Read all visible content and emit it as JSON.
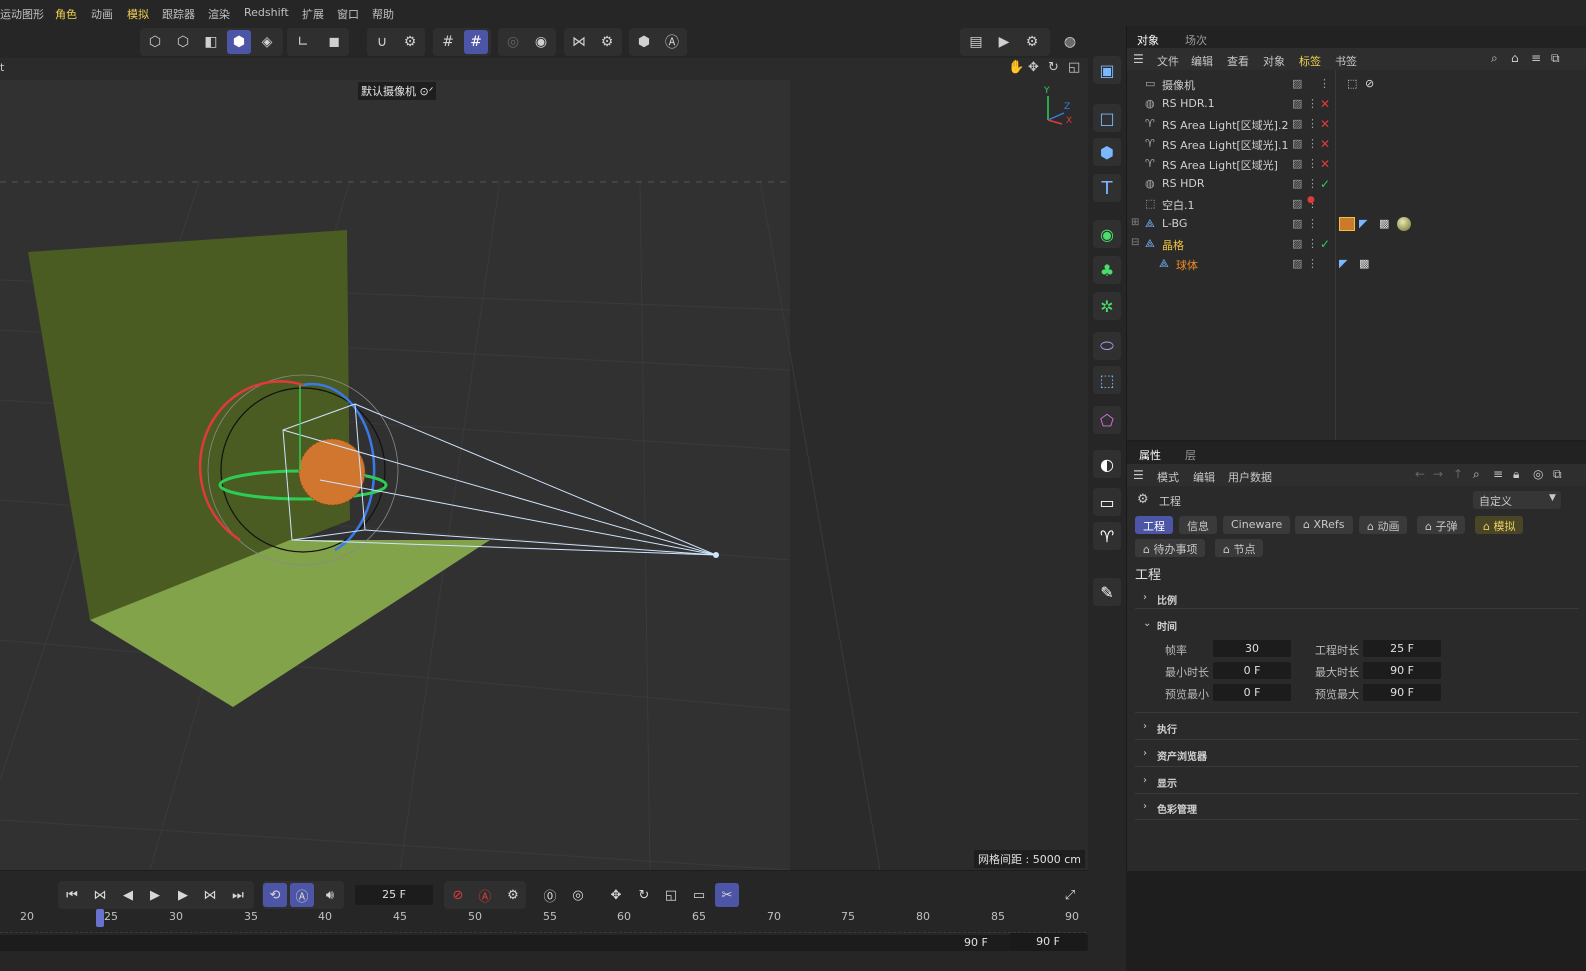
{
  "menubar": {
    "items": [
      "运动图形",
      "角色",
      "动画",
      "模拟",
      "跟踪器",
      "渲染",
      "Redshift",
      "扩展",
      "窗口",
      "帮助"
    ]
  },
  "viewport": {
    "camera_label": "默认摄像机 ⊙ᐟ",
    "grid_spacing": "网格间距 : 5000 cm",
    "axis_y": "Y",
    "axis_z": "Z",
    "axis_x": "X",
    "corner_text": "t"
  },
  "object_panel": {
    "tabs": [
      "对象",
      "场次"
    ],
    "menu": [
      "文件",
      "编辑",
      "查看",
      "对象",
      "标签",
      "书签"
    ],
    "objects": [
      {
        "name": "摄像机",
        "color": "#d0d0d0",
        "status": "none"
      },
      {
        "name": "RS HDR.1",
        "color": "#d0d0d0",
        "status": "x"
      },
      {
        "name": "RS Area Light[区域光].2",
        "color": "#d0d0d0",
        "status": "x"
      },
      {
        "name": "RS Area Light[区域光].1",
        "color": "#d0d0d0",
        "status": "x"
      },
      {
        "name": "RS Area Light[区域光]",
        "color": "#d0d0d0",
        "status": "x"
      },
      {
        "name": "RS HDR",
        "color": "#d0d0d0",
        "status": "check"
      },
      {
        "name": "空白.1",
        "color": "#d0d0d0",
        "status": "reddot"
      },
      {
        "name": "L-BG",
        "color": "#d0d0d0",
        "status": "none"
      },
      {
        "name": "晶格",
        "color": "#f0c040",
        "status": "check"
      },
      {
        "name": "球体",
        "color": "#f08a2a",
        "status": "none"
      }
    ]
  },
  "attr_panel": {
    "tabs": [
      "属性",
      "层"
    ],
    "menu": [
      "模式",
      "编辑",
      "用户数据"
    ],
    "context": "工程",
    "preset": "自定义",
    "chips_row1": [
      "工程",
      "信息",
      "Cineware",
      "XRefs",
      "动画",
      "子弹",
      "模拟"
    ],
    "chips_row2": [
      "待办事项",
      "节点"
    ],
    "heading": "工程",
    "sections": [
      "比例",
      "时间",
      "执行",
      "资产浏览器",
      "显示",
      "色彩管理"
    ],
    "time": {
      "fps_label": "帧率",
      "fps": "30",
      "duration_label": "工程时长",
      "duration": "25 F",
      "min_label": "最小时长",
      "min": "0 F",
      "max_label": "最大时长",
      "max": "90 F",
      "pmin_label": "预览最小",
      "pmin": "0 F",
      "pmax_label": "预览最大",
      "pmax": "90 F"
    }
  },
  "timeline": {
    "current_frame": "25 F",
    "ticks": [
      "20",
      "25",
      "30",
      "35",
      "40",
      "45",
      "50",
      "55",
      "60",
      "65",
      "70",
      "75",
      "80",
      "85",
      "90"
    ],
    "end_left": "90 F",
    "end_right": "90 F"
  },
  "colors": {
    "accent": "#4d55a6",
    "wall": "#4a5c22",
    "floor": "#82a34a"
  }
}
